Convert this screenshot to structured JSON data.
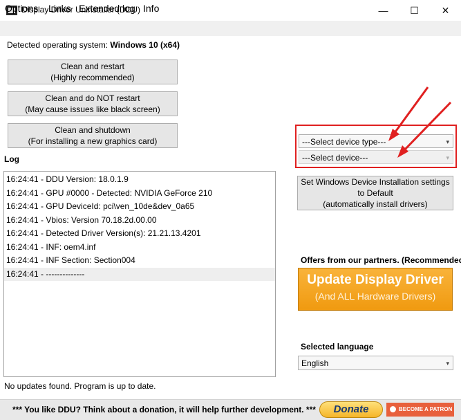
{
  "window": {
    "title": "Display Driver Uninstaller (DDU)",
    "minimize_icon": "—",
    "maximize_icon": "☐",
    "close_icon": "✕"
  },
  "menu": {
    "items": [
      "Options",
      "Links",
      "Extended log",
      "Info"
    ]
  },
  "os": {
    "label": "Detected operating system:",
    "value": "Windows 10 (x64)"
  },
  "buttons": {
    "clean_restart": {
      "line1": "Clean and restart",
      "line2": "(Highly recommended)"
    },
    "clean_no_restart": {
      "line1": "Clean and do NOT restart",
      "line2": "(May cause issues like black screen)"
    },
    "clean_shutdown": {
      "line1": "Clean and shutdown",
      "line2": "(For installing a new graphics card)"
    },
    "set_default": {
      "line1": "Set Windows Device Installation settings",
      "line2": "to Default",
      "line3": "(automatically install drivers)"
    }
  },
  "log": {
    "label": "Log",
    "entries": [
      "16:24:41 - DDU Version: 18.0.1.9",
      "16:24:41 - GPU #0000 - Detected: NVIDIA GeForce 210",
      "16:24:41 - GPU DeviceId: pci\\ven_10de&dev_0a65",
      "16:24:41 - Vbios: Version 70.18.2d.00.00",
      "16:24:41 - Detected Driver Version(s): 21.21.13.4201",
      "16:24:41 - INF: oem4.inf",
      "16:24:41 - INF Section: Section004",
      "16:24:41 - --------------"
    ]
  },
  "device_type_select": {
    "value": "---Select device type---",
    "chevron": "▾"
  },
  "device_select": {
    "value": "---Select device---",
    "chevron": "▾"
  },
  "partners": {
    "label": "Offers from our partners. (Recommended)",
    "banner_title": "Update Display Driver",
    "banner_sub": "(And ALL Hardware Drivers)"
  },
  "language": {
    "label": "Selected language",
    "value": "English",
    "chevron": "▾"
  },
  "status": "No updates found. Program is up to date.",
  "footer": {
    "message": "*** You like DDU? Think about a donation, it will help further development. ***",
    "donate_label": "Donate",
    "patron_label": "BECOME A PATRON"
  },
  "colors": {
    "highlight": "#e02020",
    "banner": "#f5a623"
  }
}
